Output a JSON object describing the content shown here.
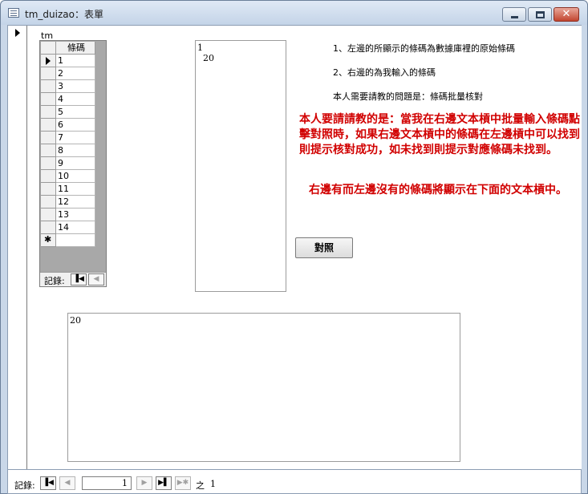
{
  "window": {
    "title": "tm_duizao：表單"
  },
  "subform": {
    "label": "tm",
    "column_header": "條碼",
    "rows": [
      "1",
      "2",
      "3",
      "4",
      "5",
      "6",
      "7",
      "8",
      "9",
      "10",
      "11",
      "12",
      "13",
      "14"
    ],
    "nav_label": "記錄:"
  },
  "textbox_right": {
    "value": "1\n  20"
  },
  "textbox_bottom": {
    "value": "20"
  },
  "notes": {
    "line1": "1、左邊的所顯示的條碼為數據庫裡的原始條碼",
    "line2": "2、右邊的為我輸入的條碼",
    "line3": "本人需要請教的問題是：條碼批量核對",
    "red1": "本人要請請教的是：當我在右邊文本槓中批量輸入條碼點擊對照時，如果右邊文本槓中的條碼在左邊槓中可以找到則提示核對成功，如未找到則提示對應條碼未找到。",
    "red2": "右邊有而左邊沒有的條碼將顯示在下面的文本槓中。"
  },
  "compare_button": {
    "label": "對照"
  },
  "record_nav": {
    "label": "記錄:",
    "current": "1",
    "of_label": "之",
    "total": "1"
  },
  "colors": {
    "red_text": "#d10000",
    "titlebar": "#c4d4e8"
  }
}
